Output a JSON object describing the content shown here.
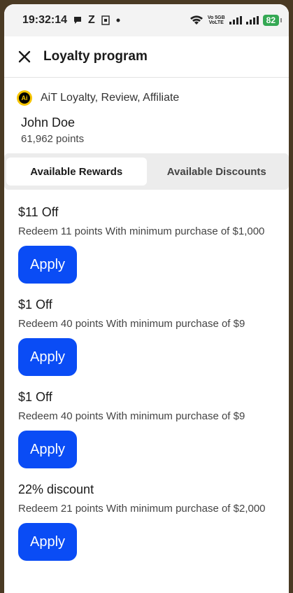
{
  "status_bar": {
    "time": "19:32:14",
    "carrier_letter": "Z",
    "volte_top": "Vo 5GB",
    "volte_bottom": "VoLTE",
    "battery": "82"
  },
  "header": {
    "title": "Loyalty program"
  },
  "app": {
    "name": "AiT Loyalty, Review, Affiliate",
    "logo_text": "Ai"
  },
  "user": {
    "name": "John Doe",
    "points": "61,962 points"
  },
  "tabs": [
    {
      "label": "Available Rewards",
      "active": true
    },
    {
      "label": "Available Discounts",
      "active": false
    }
  ],
  "rewards": [
    {
      "title": "$11 Off",
      "description": "Redeem 11 points With minimum purchase of $1,000",
      "button": "Apply"
    },
    {
      "title": "$1 Off",
      "description": "Redeem 40 points With minimum purchase of $9",
      "button": "Apply"
    },
    {
      "title": "$1 Off",
      "description": "Redeem 40 points With minimum purchase of $9",
      "button": "Apply"
    },
    {
      "title": "22% discount",
      "description": "Redeem 21 points With minimum purchase of $2,000",
      "button": "Apply"
    }
  ],
  "colors": {
    "accent": "#0a4cf5",
    "battery": "#34a853",
    "logo": "#f5c400"
  }
}
